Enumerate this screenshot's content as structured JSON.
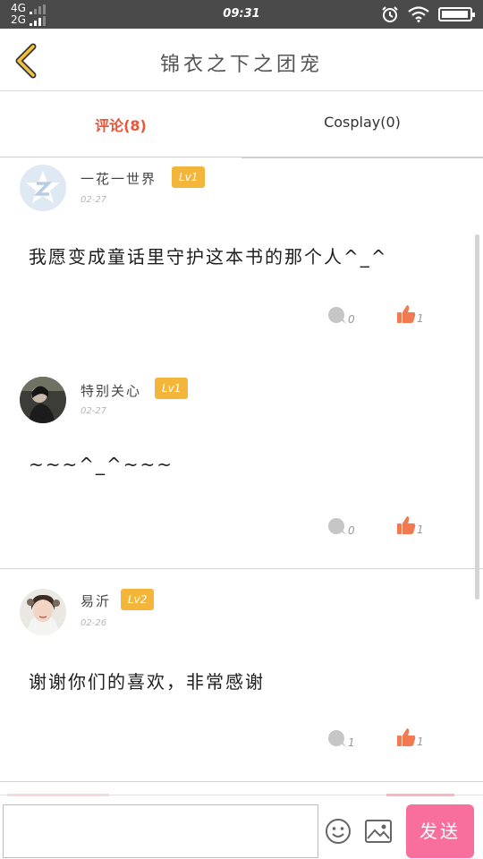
{
  "status_bar": {
    "network_top": "4G",
    "network_bottom": "2G",
    "time": "09:31",
    "battery_level": 0.95
  },
  "header": {
    "title": "锦衣之下之团宠",
    "back_icon": "chevron-left-icon"
  },
  "tabs": [
    {
      "label": "评论(8)",
      "active": true
    },
    {
      "label": "Cosplay(0)",
      "active": false
    }
  ],
  "comments": [
    {
      "username": "一花一世界",
      "level": "Lv1",
      "date": "02-27",
      "text": "我愿变成童话里守护这本书的那个人^_^",
      "reply_count": "0",
      "like_count": "1",
      "avatar": "default-z-avatar"
    },
    {
      "username": "特别关心",
      "level": "Lv1",
      "date": "02-27",
      "text": "~~~^_^~~~",
      "reply_count": "0",
      "like_count": "1",
      "avatar": "photo-avatar-dark"
    },
    {
      "username": "易沂",
      "level": "Lv2",
      "date": "02-26",
      "text": "谢谢你们的喜欢，非常感谢",
      "reply_count": "1",
      "like_count": "1",
      "avatar": "photo-avatar-portrait"
    }
  ],
  "composer": {
    "input_value": "",
    "send_label": "发送"
  },
  "colors": {
    "accent": "#e8553a",
    "badge": "#f3b63a",
    "like": "#f07a52",
    "send": "#f86f9d",
    "status_bar": "#4a4a4a"
  }
}
